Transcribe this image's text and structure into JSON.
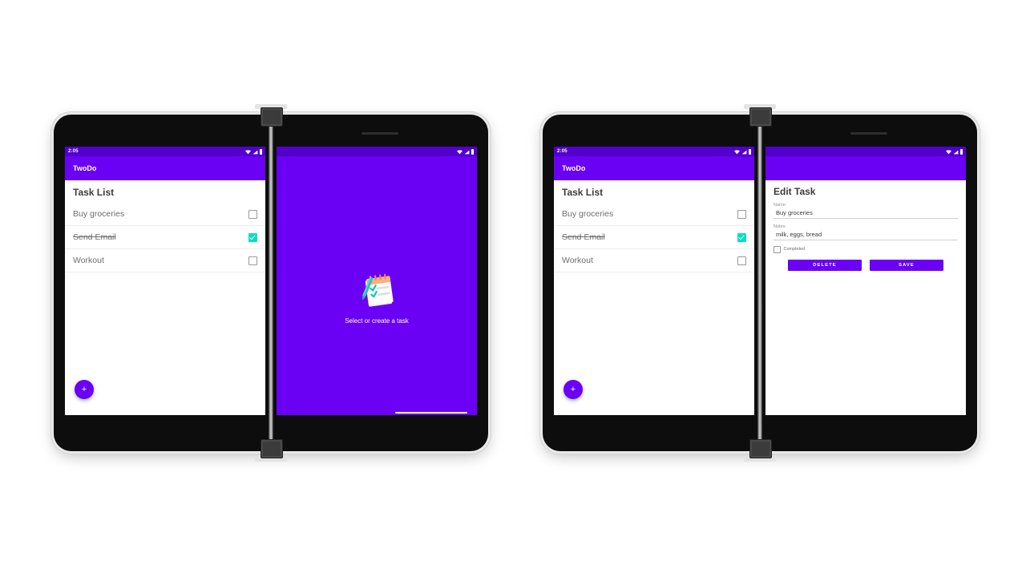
{
  "theme": {
    "primary": "#6a00f4",
    "status_bar": "#5200cc",
    "accent_check": "#00e0c0",
    "surface": "#ffffff",
    "text_muted": "#6e6e6e"
  },
  "status_bar": {
    "time": "2:05",
    "icons": [
      "wifi-icon",
      "signal-icon",
      "battery-icon"
    ]
  },
  "app": {
    "title": "TwoDo"
  },
  "task_list": {
    "heading": "Task List",
    "items": [
      {
        "label": "Buy groceries",
        "completed": false
      },
      {
        "label": "Send Email",
        "completed": true
      },
      {
        "label": "Workout",
        "completed": false
      }
    ],
    "fab_label": "+"
  },
  "empty_pane": {
    "message": "Select or create a task",
    "illustration": "notepad-checklist-icon"
  },
  "edit_task": {
    "heading": "Edit Task",
    "name_label": "Name:",
    "name_value": "Buy groceries",
    "notes_label": "Notes:",
    "notes_value": "milk, eggs, bread",
    "completed_label": "Completed",
    "completed_checked": false,
    "delete_label": "DELETE",
    "save_label": "SAVE"
  }
}
